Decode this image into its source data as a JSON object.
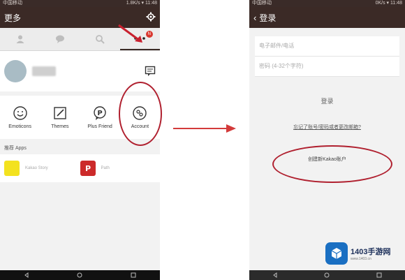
{
  "left": {
    "status": {
      "carrier": "中国移动",
      "right": "1.8K/s ▾ 11:48"
    },
    "title": "更多",
    "tabs": [
      {
        "name": "tab-friends",
        "icon": "person-icon"
      },
      {
        "name": "tab-chats",
        "icon": "chat-bubble-icon"
      },
      {
        "name": "tab-search",
        "icon": "search-icon"
      },
      {
        "name": "tab-more",
        "icon": "more-dots-icon",
        "badge": "N"
      }
    ],
    "grid": [
      {
        "label": "Emoticons",
        "icon": "smiley-icon"
      },
      {
        "label": "Themes",
        "icon": "brush-icon"
      },
      {
        "label": "Plus Friend",
        "icon": "plus-friend-icon"
      },
      {
        "label": "Account",
        "icon": "account-icon"
      }
    ],
    "section_title": "推荐 Apps",
    "apps": [
      {
        "label": "Kakao Story",
        "color": "#f3e21f"
      },
      {
        "label": "Path",
        "color": "#cc2a2a"
      }
    ]
  },
  "right": {
    "status": {
      "carrier": "中国移动",
      "right": "0K/s ▾ 11:48"
    },
    "title": "登录",
    "email_placeholder": "电子邮件/电话",
    "password_placeholder": "密码 (4-32个字符)",
    "login_label": "登录",
    "forgot_label": "忘记了账号/密码或者更改邮箱?",
    "create_label": "创建新Kakao账户"
  },
  "watermark": {
    "title": "1403手游网",
    "url": "www.1403.cn"
  },
  "colors": {
    "header": "#3b2a26",
    "annotation": "#b0202f",
    "badge": "#d9372f"
  }
}
